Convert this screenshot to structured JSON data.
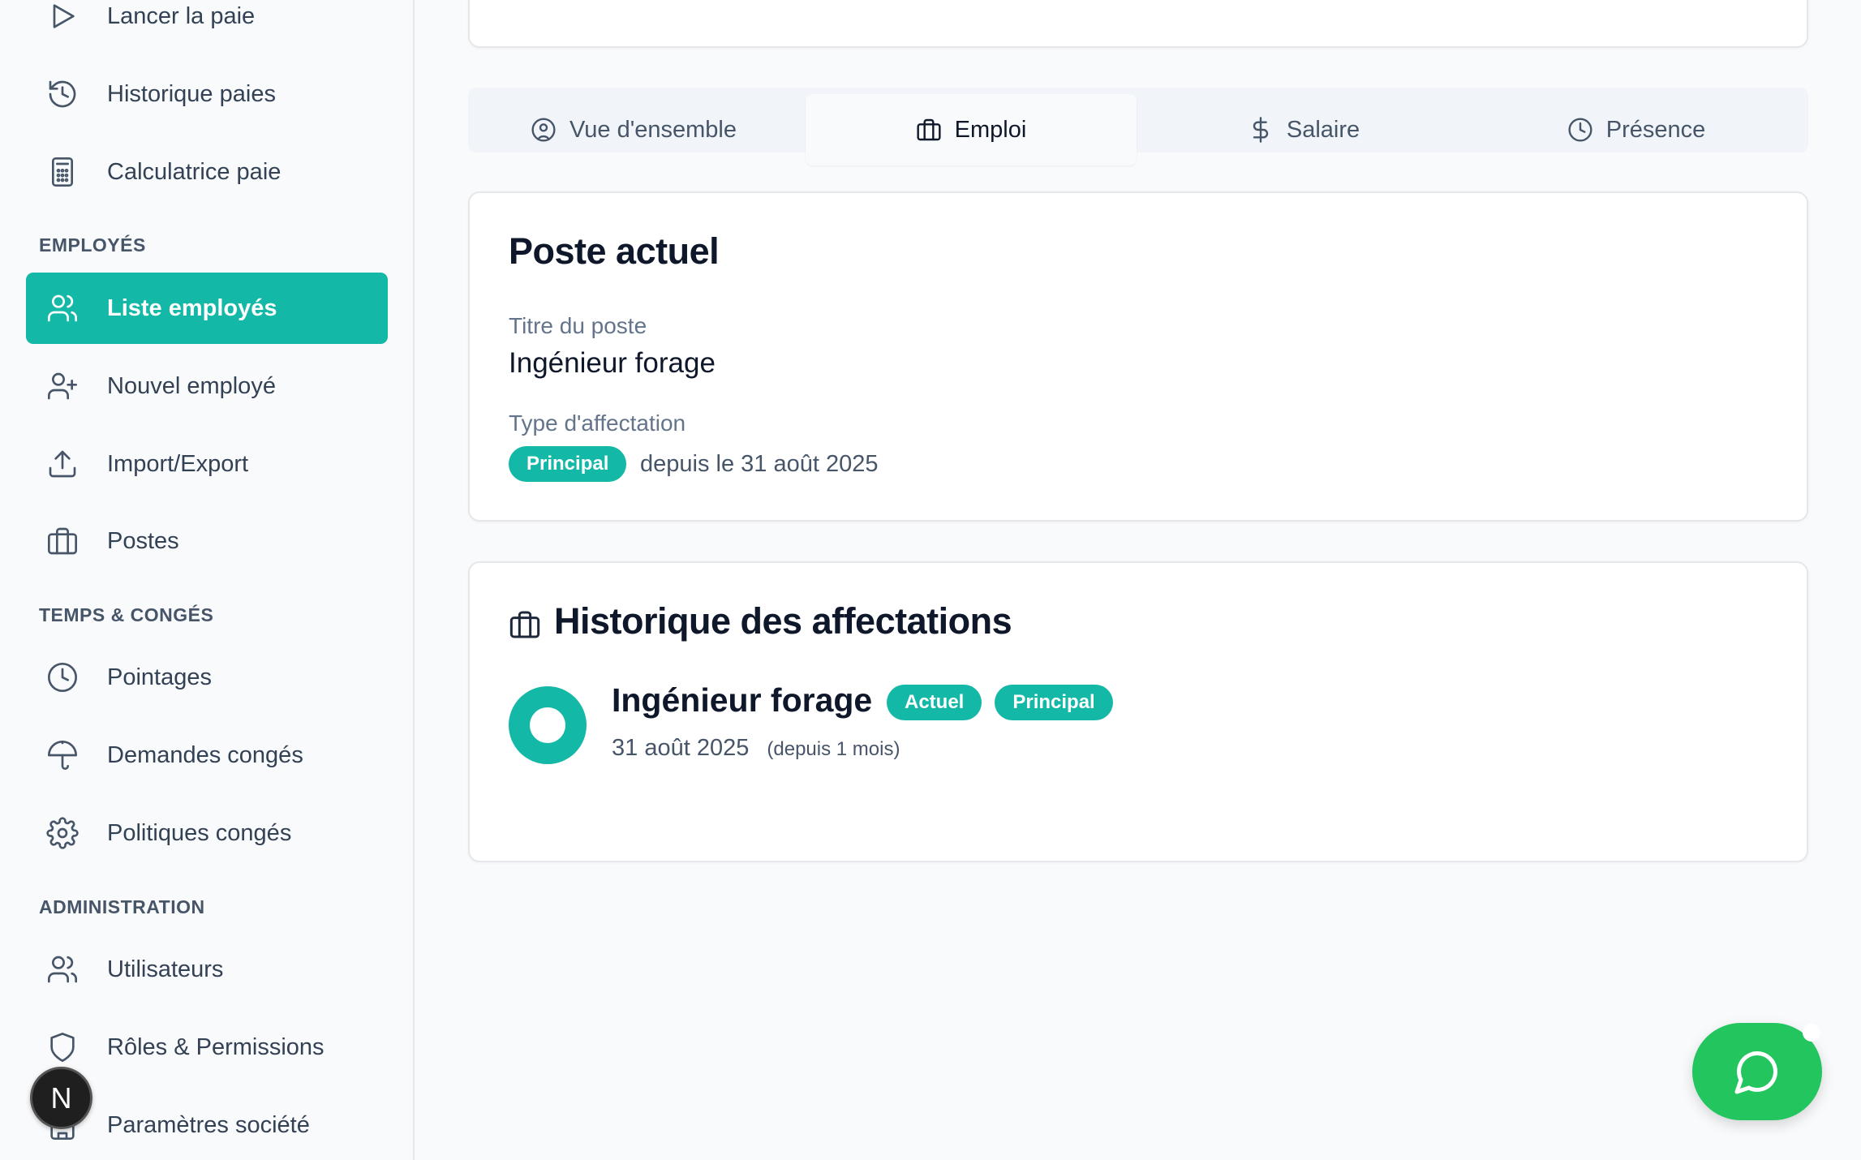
{
  "sidebar": {
    "top_items": [
      {
        "label": "Lancer la paie",
        "icon": "play-icon"
      },
      {
        "label": "Historique paies",
        "icon": "history-icon"
      },
      {
        "label": "Calculatrice paie",
        "icon": "calculator-icon"
      }
    ],
    "sections": [
      {
        "title": "EMPLOYÉS",
        "items": [
          {
            "label": "Liste employés",
            "icon": "users-icon",
            "active": true
          },
          {
            "label": "Nouvel employé",
            "icon": "user-plus-icon"
          },
          {
            "label": "Import/Export",
            "icon": "upload-icon"
          },
          {
            "label": "Postes",
            "icon": "briefcase-icon"
          }
        ]
      },
      {
        "title": "TEMPS & CONGÉS",
        "items": [
          {
            "label": "Pointages",
            "icon": "clock-icon"
          },
          {
            "label": "Demandes congés",
            "icon": "umbrella-icon"
          },
          {
            "label": "Politiques congés",
            "icon": "gear-icon"
          }
        ]
      },
      {
        "title": "ADMINISTRATION",
        "items": [
          {
            "label": "Utilisateurs",
            "icon": "users-icon"
          },
          {
            "label": "Rôles & Permissions",
            "icon": "shield-icon"
          },
          {
            "label": "Paramètres société",
            "icon": "building-icon"
          }
        ]
      }
    ],
    "badge_letter": "N"
  },
  "tabs": [
    {
      "label": "Vue d'ensemble",
      "icon": "user-circle-icon"
    },
    {
      "label": "Emploi",
      "icon": "briefcase-icon",
      "active": true
    },
    {
      "label": "Salaire",
      "icon": "dollar-icon"
    },
    {
      "label": "Présence",
      "icon": "clock-icon"
    }
  ],
  "current_position": {
    "title": "Poste actuel",
    "job_title_label": "Titre du poste",
    "job_title_value": "Ingénieur forage",
    "assignment_type_label": "Type d'affectation",
    "assignment_type_badge": "Principal",
    "since_text": "depuis le 31 août 2025"
  },
  "history": {
    "title": "Historique des affectations",
    "entries": [
      {
        "title": "Ingénieur forage",
        "badges": [
          "Actuel",
          "Principal"
        ],
        "date": "31 août 2025",
        "relative": "(depuis 1 mois)"
      }
    ]
  },
  "colors": {
    "accent": "#14b8a6",
    "chat": "#22c55e"
  }
}
